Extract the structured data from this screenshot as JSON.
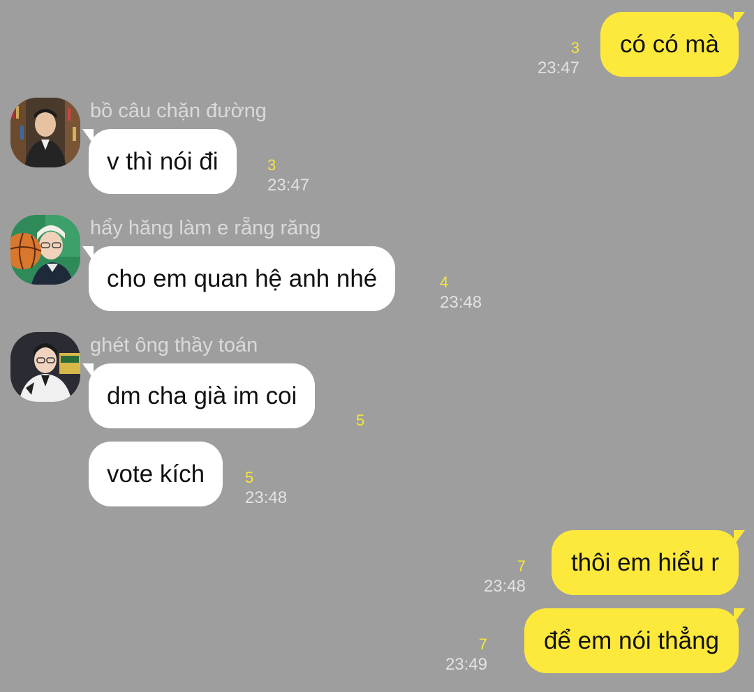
{
  "colors": {
    "background": "#9e9e9e",
    "incoming_bubble": "#ffffff",
    "outgoing_bubble": "#fde93c",
    "unread_count": "#f6e63b",
    "meta_text": "#e2e2e2"
  },
  "messages": [
    {
      "direction": "outgoing",
      "text": "có có mà",
      "unread": "3",
      "time": "23:47"
    },
    {
      "direction": "incoming",
      "sender": "bồ câu chặn đường",
      "avatar_icon": "user-photo-avatar-icon",
      "text": "v thì nói đi",
      "unread": "3",
      "time": "23:47"
    },
    {
      "direction": "incoming",
      "sender": "hẩy hăng làm e rẵng răng",
      "avatar_icon": "user-photo-avatar-icon",
      "text": "cho em quan hệ anh nhé",
      "unread": "4",
      "time": "23:48"
    },
    {
      "direction": "incoming",
      "sender": "ghét ông thầy toán",
      "avatar_icon": "user-photo-avatar-icon",
      "text": "dm cha già im coi",
      "unread": "5"
    },
    {
      "direction": "incoming",
      "text": "vote kích",
      "unread": "5",
      "time": "23:48"
    },
    {
      "direction": "outgoing",
      "text": "thôi em hiểu r",
      "unread": "7",
      "time": "23:48"
    },
    {
      "direction": "outgoing",
      "text": "để em nói thẳng",
      "unread": "7",
      "time": "23:49"
    }
  ]
}
